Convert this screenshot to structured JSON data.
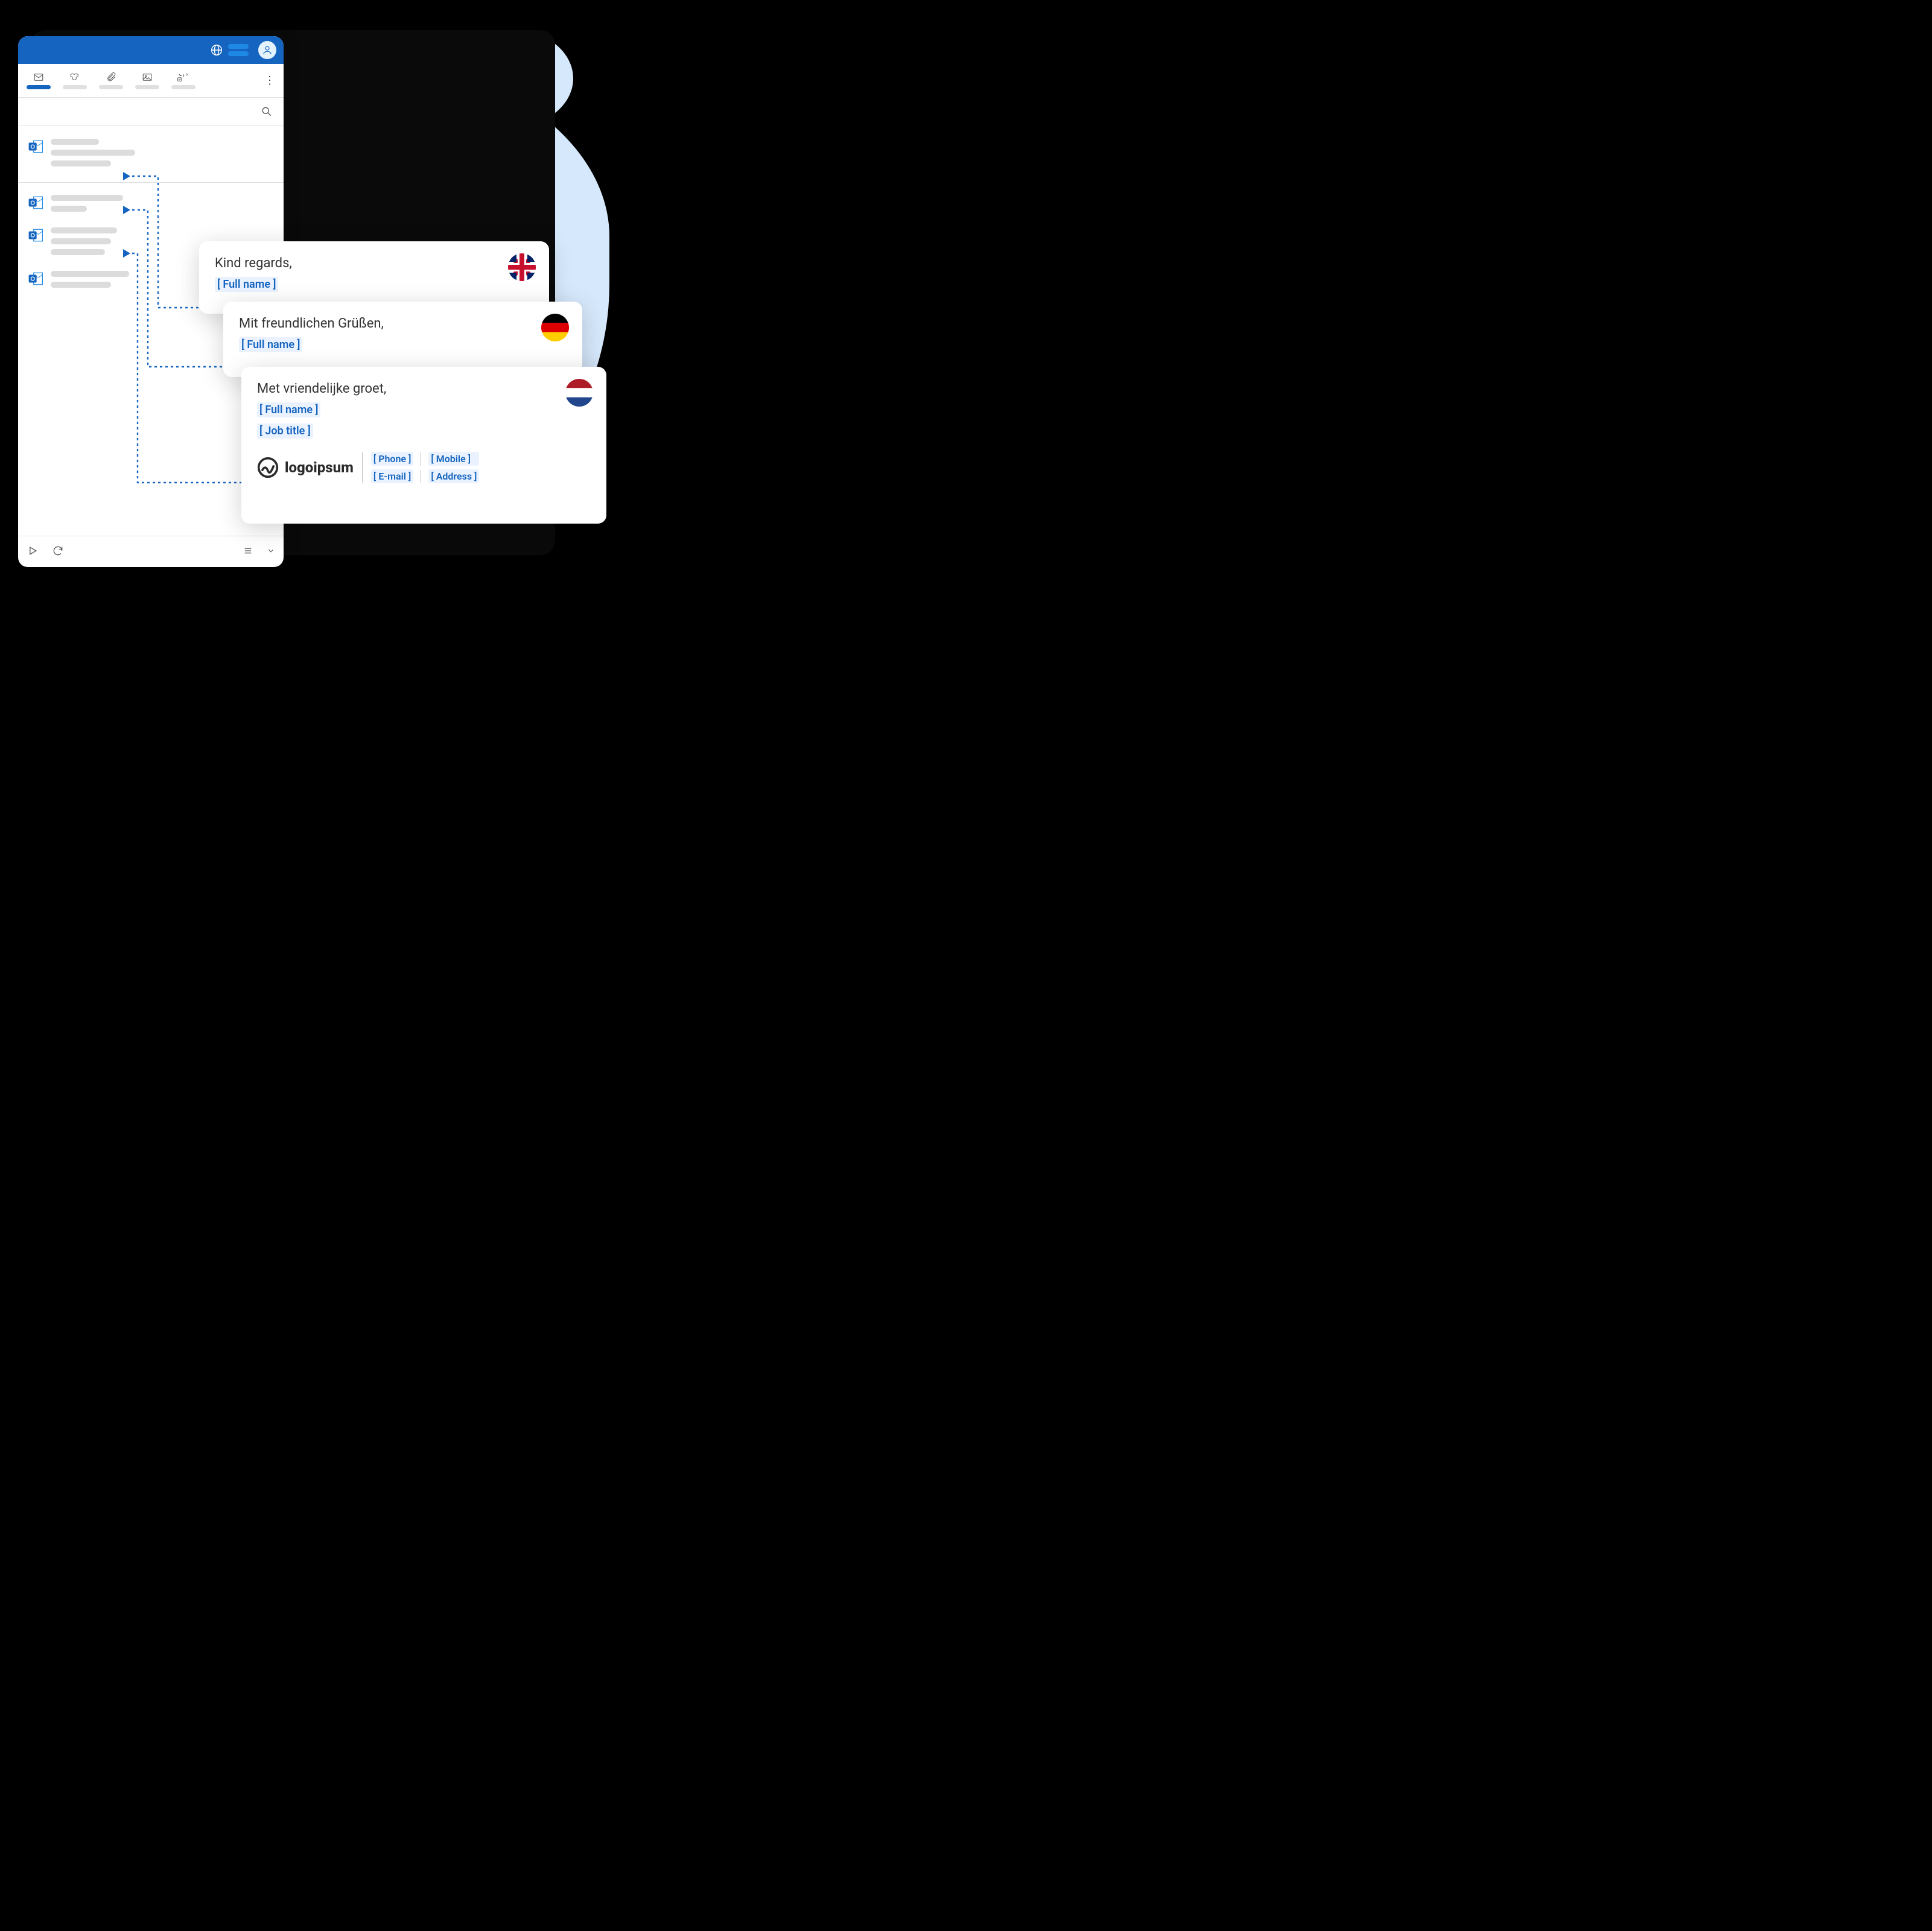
{
  "header": {
    "globe": "globe",
    "avatar": "user"
  },
  "toolbar": {
    "items": [
      {
        "icon": "mail"
      },
      {
        "icon": "cube"
      },
      {
        "icon": "clip"
      },
      {
        "icon": "image"
      },
      {
        "icon": "media"
      }
    ]
  },
  "messages": [
    {
      "lines": [
        80,
        140,
        100
      ]
    },
    {
      "lines": [
        120,
        60
      ]
    },
    {
      "lines": [
        110,
        100,
        90
      ]
    },
    {
      "lines": [
        130,
        100
      ]
    }
  ],
  "signatures": [
    {
      "closing": "Kind regards,",
      "name_token": "[ Full name ]",
      "flag": "uk"
    },
    {
      "closing": "Mit freundlichen Grüßen,",
      "name_token": "[ Full name ]",
      "flag": "de"
    },
    {
      "closing": "Met vriendelijke groet,",
      "name_token": "[ Full name ]",
      "title_token": "[ Job title ]",
      "flag": "nl",
      "logo": "logoipsum",
      "fields": {
        "phone": "[ Phone ]",
        "mobile": "[ Mobile ]",
        "email": "[ E-mail ]",
        "address": "[ Address ]"
      }
    }
  ]
}
